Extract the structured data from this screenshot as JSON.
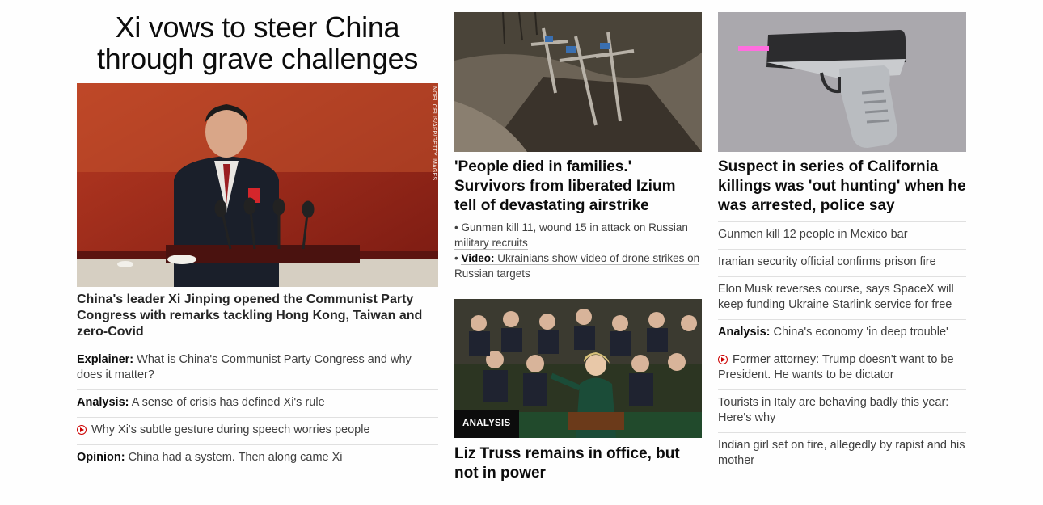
{
  "lead": {
    "title": "Xi vows to steer China through grave challenges",
    "image_credit": "NOEL CELIS/AFP/GETTY IMAGES",
    "caption": "China's leader Xi Jinping opened the Communist Party Congress with remarks tackling Hong Kong, Taiwan and zero-Covid",
    "related": [
      {
        "prefix": "Explainer:",
        "text": "What is China's Communist Party Congress and why does it matter?"
      },
      {
        "prefix": "Analysis:",
        "text": "A sense of crisis has defined Xi's rule"
      },
      {
        "video": true,
        "text": "Why Xi's subtle gesture during speech worries people"
      },
      {
        "prefix": "Opinion:",
        "text": "China had a system. Then along came Xi"
      }
    ]
  },
  "middle": {
    "headline": "'People died in families.' Survivors from liberated Izium tell of devastating airstrike",
    "bullet1": "Gunmen kill 11, wound 15 in attack on Russian military recruits",
    "bullet2_prefix": "Video:",
    "bullet2": "Ukrainians show video of drone strikes on Russian targets",
    "badge": "ANALYSIS",
    "headline2": "Liz Truss remains in office, but not in power"
  },
  "right": {
    "headline": "Suspect in series of California killings was 'out hunting' when he was arrested, police say",
    "items": [
      "Gunmen kill 12 people in Mexico bar",
      "Iranian security official confirms prison fire",
      "Elon Musk reverses course, says SpaceX will keep funding Ukraine Starlink service for free",
      "China's economy 'in deep trouble'",
      "Former attorney: Trump doesn't want to be President. He wants to be dictator",
      "Tourists in Italy are behaving badly this year: Here's why",
      "Indian girl set on fire, allegedly by rapist and his mother"
    ],
    "analysis_prefix": "Analysis:"
  }
}
